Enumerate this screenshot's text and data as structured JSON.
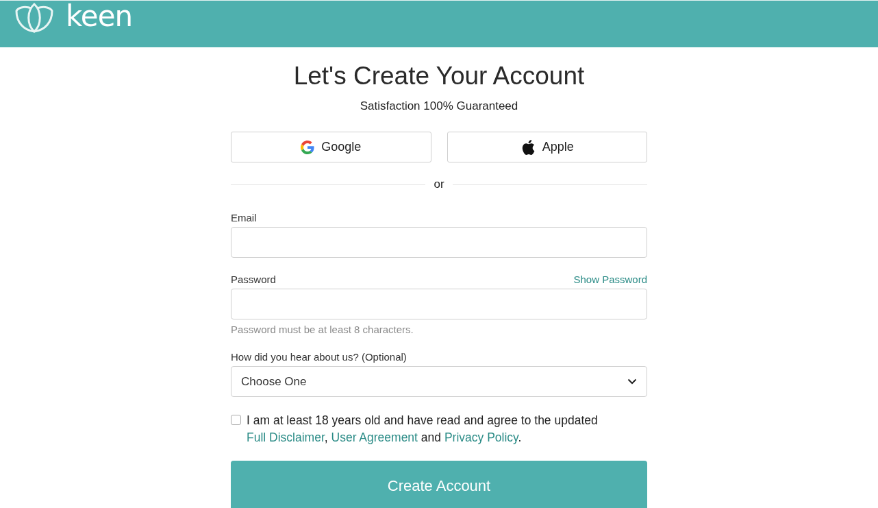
{
  "header": {
    "logo_text": "keen"
  },
  "title": "Let's Create Your Account",
  "subtitle": "Satisfaction 100% Guaranteed",
  "social_buttons": [
    {
      "kind": "google",
      "label": "Google"
    },
    {
      "kind": "apple",
      "label": "Apple"
    }
  ],
  "divider_text": "or",
  "fields": [
    {
      "kind": "text",
      "label": "Email"
    },
    {
      "kind": "password",
      "label": "Password",
      "action": "Show Password",
      "hint": "Password must be at least 8 characters."
    },
    {
      "kind": "select",
      "label": "How did you hear about us? (Optional)",
      "value": "Choose One"
    }
  ],
  "agreement": {
    "checked": false,
    "parts": [
      {
        "kind": "text",
        "text": "I am at least 18 years old and have read and agree to the updated "
      },
      {
        "kind": "link",
        "text": "Full Disclaimer"
      },
      {
        "kind": "text",
        "text": ", "
      },
      {
        "kind": "link",
        "text": "User Agreement"
      },
      {
        "kind": "text",
        "text": " and "
      },
      {
        "kind": "link",
        "text": "Privacy Policy"
      },
      {
        "kind": "text",
        "text": "."
      }
    ]
  },
  "submit": "Create Account"
}
